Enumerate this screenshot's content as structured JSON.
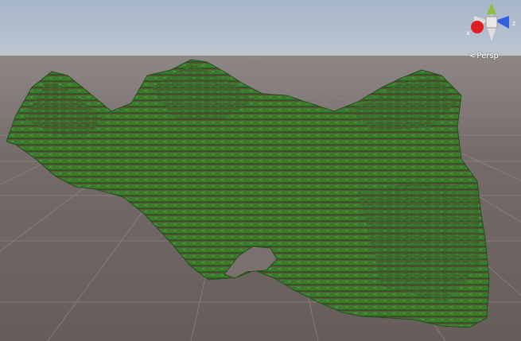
{
  "scene_view": {
    "projection_label": "Persp",
    "projection_chevron": "<",
    "gizmo": {
      "axis_x_label": "x",
      "axis_z_label": "z",
      "colors": {
        "x_axis": "#e02020",
        "y_axis": "#90c040",
        "z_axis": "#3060e0",
        "center": "#e8e8e8"
      }
    }
  },
  "colors": {
    "sky_top": "#a6b5c9",
    "horizon": "#c7c6c6",
    "ground": "#6f6663",
    "grass": "#3c7a30",
    "grass_dark": "#2a5c22",
    "dirt": "#6b4a3c"
  }
}
